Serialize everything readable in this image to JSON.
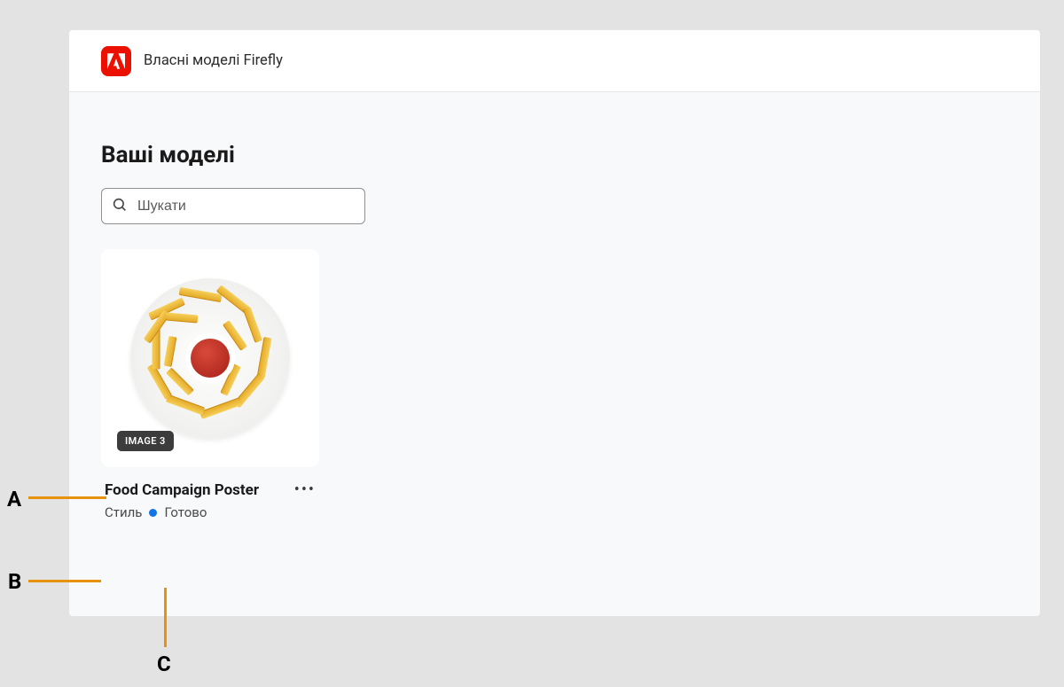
{
  "header": {
    "title": "Власні моделі Firefly"
  },
  "section": {
    "title": "Ваші моделі"
  },
  "search": {
    "placeholder": "Шукати"
  },
  "model": {
    "badge": "IMAGE 3",
    "title": "Food Campaign Poster",
    "type": "Стиль",
    "status_text": "Готово",
    "status_color": "#1473e6"
  },
  "callouts": {
    "a": "A",
    "b": "B",
    "c": "C"
  }
}
